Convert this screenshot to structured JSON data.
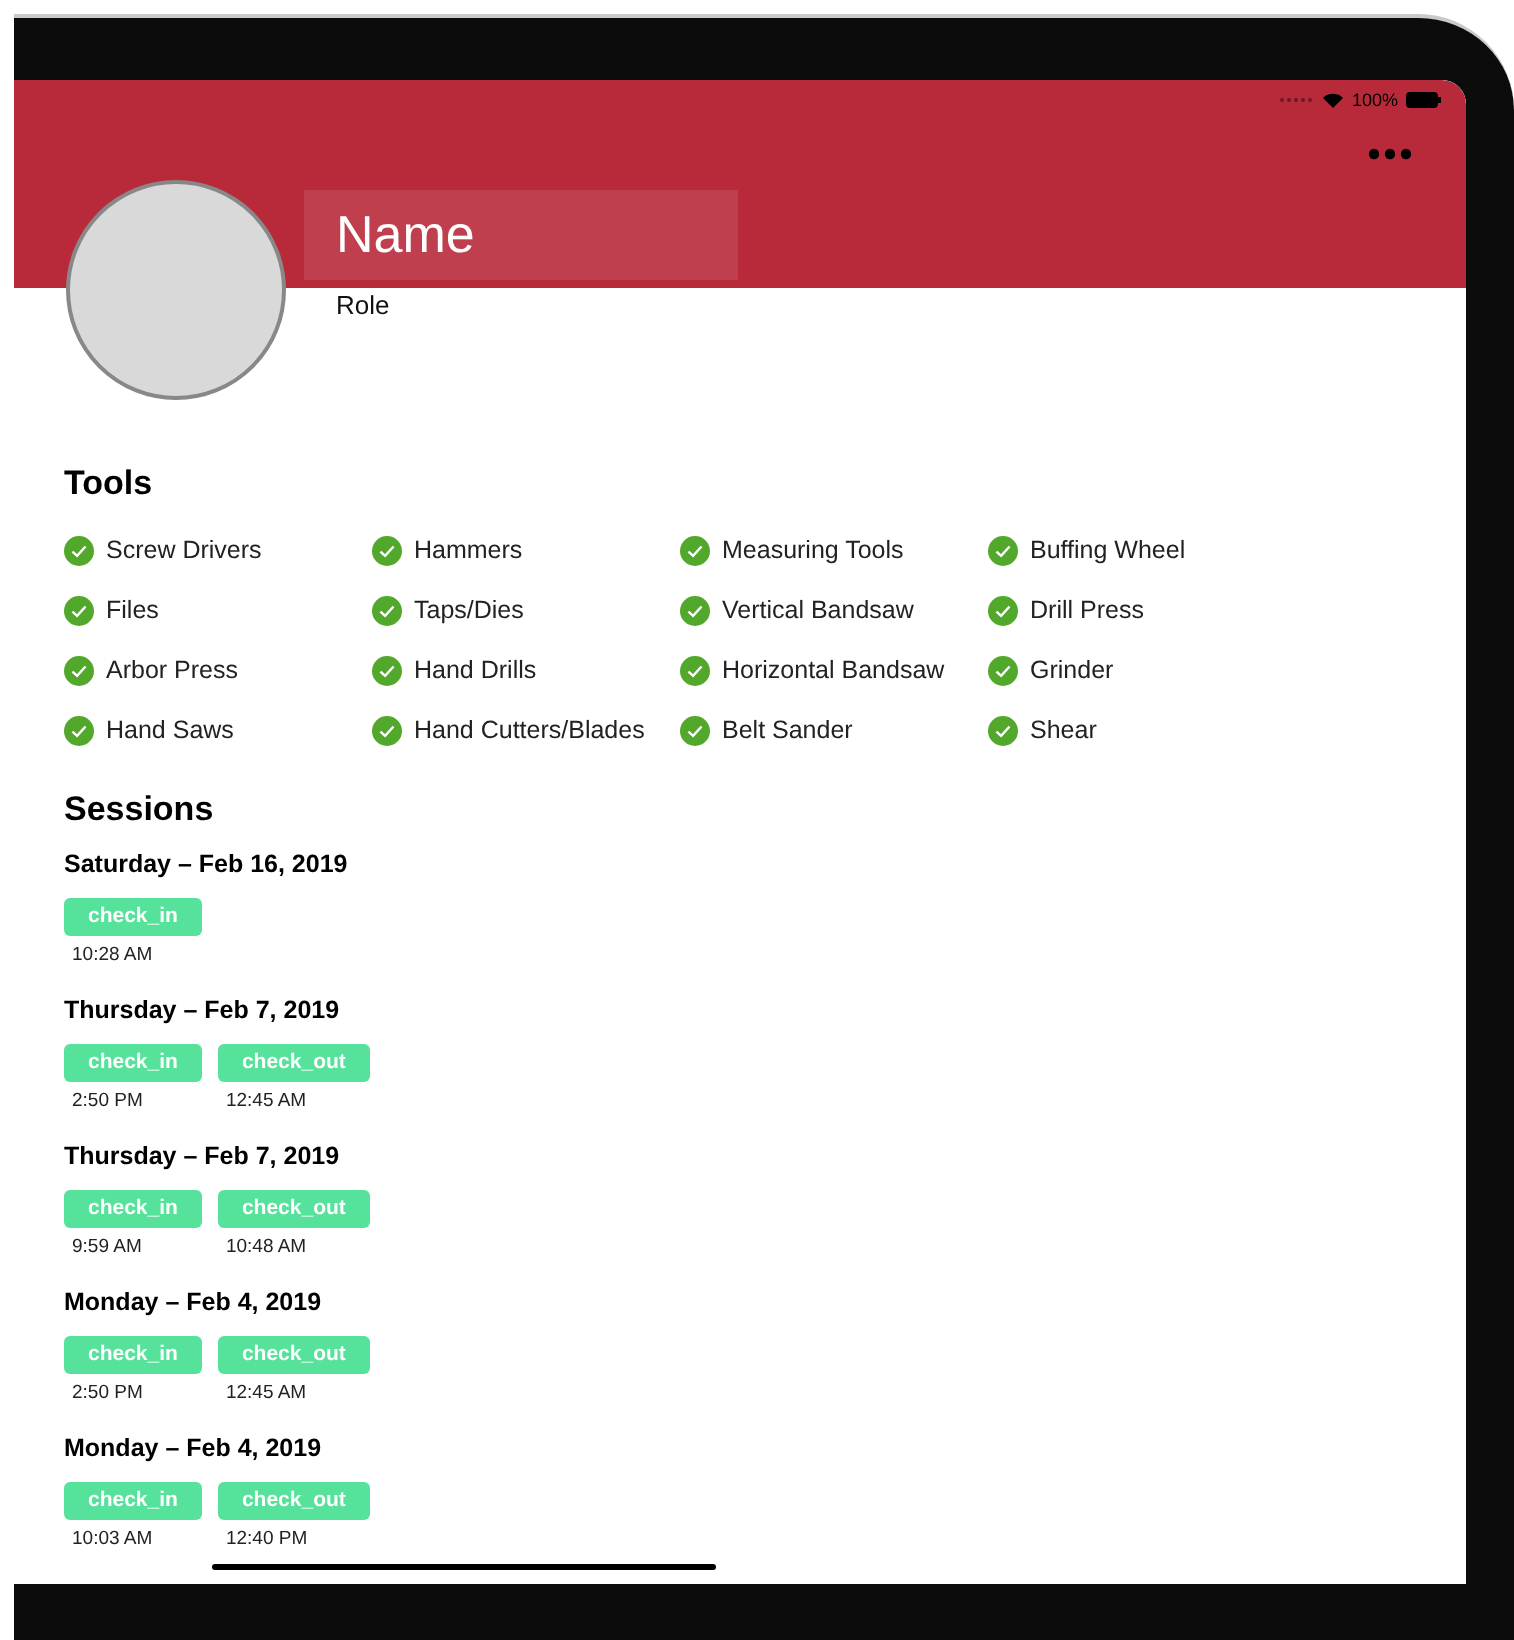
{
  "status_bar": {
    "battery": "100%"
  },
  "profile": {
    "name": "Name",
    "role": "Role"
  },
  "tools": {
    "title": "Tools",
    "items": [
      {
        "label": "Screw Drivers",
        "checked": true
      },
      {
        "label": "Hammers",
        "checked": true
      },
      {
        "label": "Measuring Tools",
        "checked": true
      },
      {
        "label": "Buffing Wheel",
        "checked": true
      },
      {
        "label": "Files",
        "checked": true
      },
      {
        "label": "Taps/Dies",
        "checked": true
      },
      {
        "label": "Vertical Bandsaw",
        "checked": true
      },
      {
        "label": "Drill Press",
        "checked": true
      },
      {
        "label": "Arbor Press",
        "checked": true
      },
      {
        "label": "Hand Drills",
        "checked": true
      },
      {
        "label": "Horizontal Bandsaw",
        "checked": true
      },
      {
        "label": "Grinder",
        "checked": true
      },
      {
        "label": "Hand Saws",
        "checked": true
      },
      {
        "label": "Hand Cutters/Blades",
        "checked": true
      },
      {
        "label": "Belt Sander",
        "checked": true
      },
      {
        "label": "Shear",
        "checked": true
      }
    ]
  },
  "sessions": {
    "title": "Sessions",
    "days": [
      {
        "date": "Saturday – Feb 16, 2019",
        "events": [
          {
            "label": "check_in",
            "time": "10:28 AM"
          }
        ]
      },
      {
        "date": "Thursday – Feb 7, 2019",
        "events": [
          {
            "label": "check_in",
            "time": "2:50 PM"
          },
          {
            "label": "check_out",
            "time": "12:45 AM"
          }
        ]
      },
      {
        "date": "Thursday – Feb 7, 2019",
        "events": [
          {
            "label": "check_in",
            "time": "9:59 AM"
          },
          {
            "label": "check_out",
            "time": "10:48 AM"
          }
        ]
      },
      {
        "date": "Monday – Feb 4, 2019",
        "events": [
          {
            "label": "check_in",
            "time": "2:50 PM"
          },
          {
            "label": "check_out",
            "time": "12:45 AM"
          }
        ]
      },
      {
        "date": "Monday – Feb 4, 2019",
        "events": [
          {
            "label": "check_in",
            "time": "10:03 AM"
          },
          {
            "label": "check_out",
            "time": "12:40 PM"
          }
        ]
      }
    ]
  }
}
